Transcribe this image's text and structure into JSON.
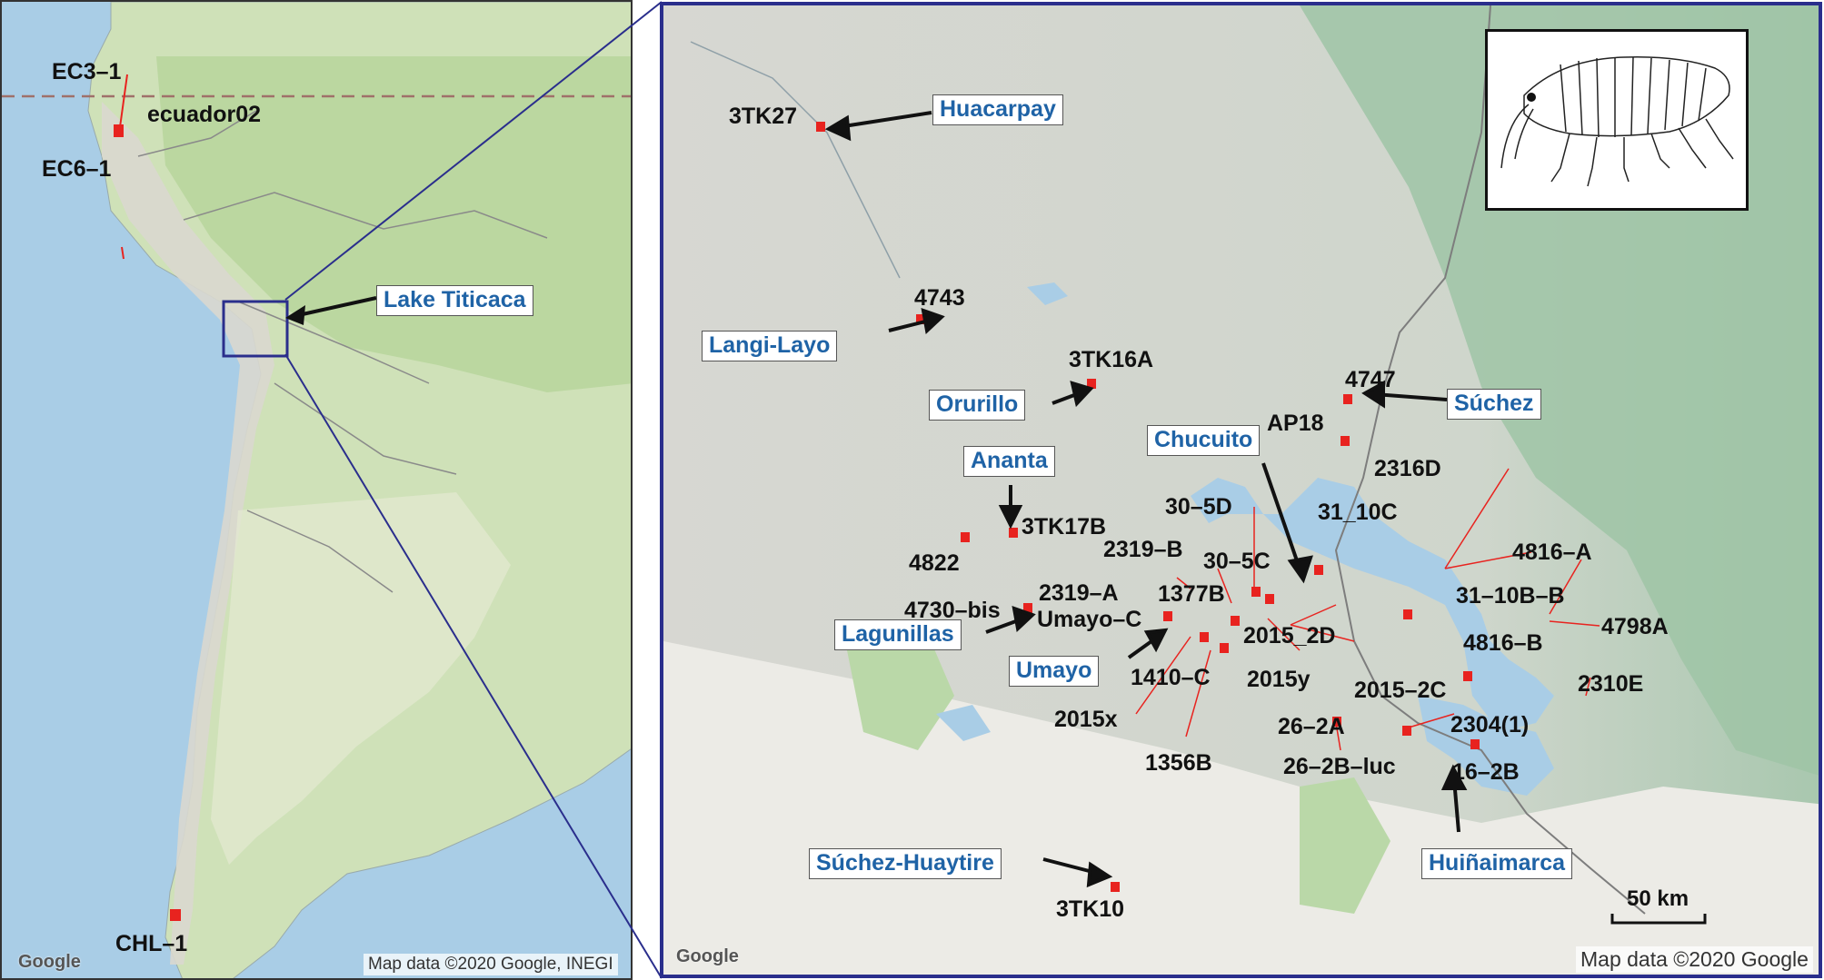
{
  "overview_map": {
    "site_labels": [
      "EC3–1",
      "ecuador02",
      "EC6–1",
      "CHL–1"
    ],
    "region_label": "Lake Titicaca",
    "credit": "Map data ©2020 Google, INEGI",
    "logo": "Google"
  },
  "detail_map": {
    "site_labels": [
      "3TK27",
      "4743",
      "3TK16A",
      "4747",
      "AP18",
      "2316D",
      "31_10C",
      "30–5D",
      "3TK17B",
      "4822",
      "2319–B",
      "30–5C",
      "4816–A",
      "31–10B–B",
      "2319–A",
      "1377B",
      "4730–bis",
      "Umayo–C",
      "4798A",
      "2015_2D",
      "4816–B",
      "1410–C",
      "2015y",
      "2015–2C",
      "2310E",
      "2015x",
      "26–2A",
      "2304(1)",
      "1356B",
      "26–2B–luc",
      "16–2B",
      "3TK10"
    ],
    "region_labels": [
      "Huacarpay",
      "Langi-Layo",
      "Orurillo",
      "Súchez",
      "Chucuito",
      "Ananta",
      "Lagunillas",
      "Umayo",
      "Huiñaimarca",
      "Súchez-Huaytire"
    ],
    "scale_bar": "50 km",
    "credit": "Map data ©2020 Google",
    "logo": "Google",
    "inset_icon": "amphipod-drawing-icon"
  },
  "colors": {
    "marker": "#e8231f",
    "region_text": "#1f63a6",
    "frame": "#2a2e8c",
    "water": "#a9cde6",
    "lake": "#a9cde6"
  }
}
